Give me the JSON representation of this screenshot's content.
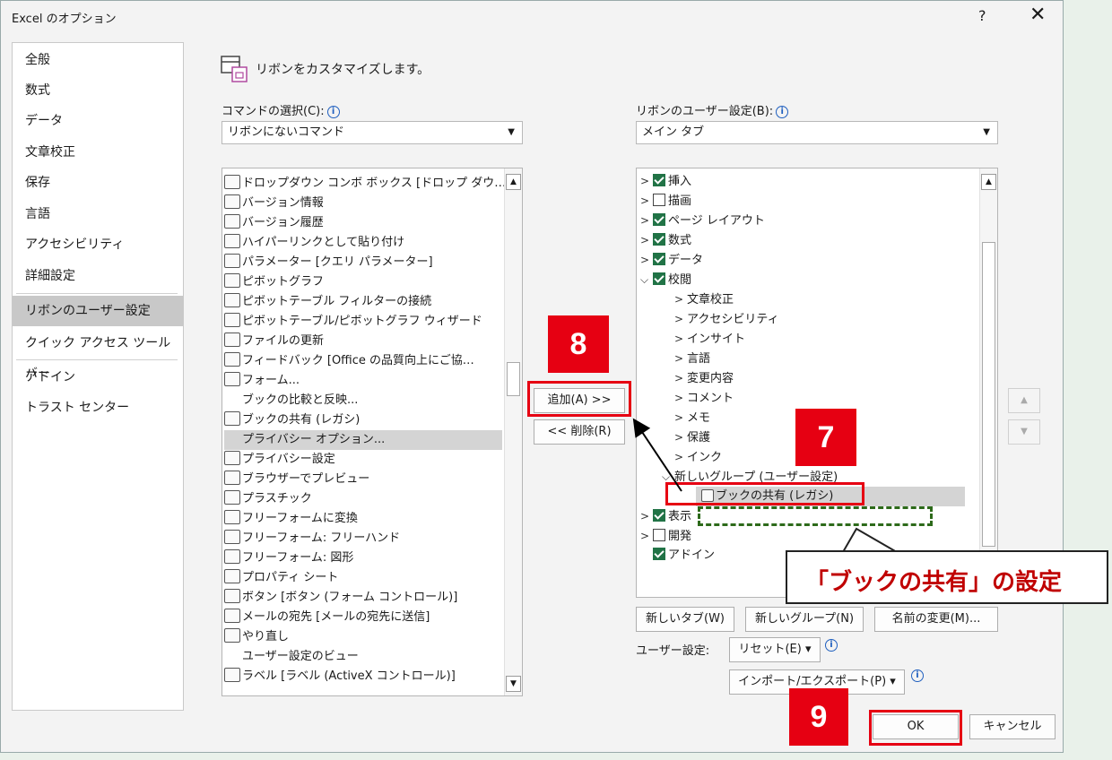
{
  "window": {
    "title": "Excel のオプション",
    "help": "?",
    "close": "✕"
  },
  "nav": [
    {
      "label": "全般"
    },
    {
      "label": "数式"
    },
    {
      "label": "データ"
    },
    {
      "label": "文章校正"
    },
    {
      "label": "保存"
    },
    {
      "label": "言語"
    },
    {
      "label": "アクセシビリティ"
    },
    {
      "label": "詳細設定"
    },
    {
      "label": "リボンのユーザー設定"
    },
    {
      "label": "クイック アクセス ツール バー"
    },
    {
      "label": "アドイン"
    },
    {
      "label": "トラスト センター"
    }
  ],
  "header": {
    "text": "リボンをカスタマイズします。"
  },
  "left": {
    "label": "コマンドの選択(C):",
    "combo": "リボンにないコマンド",
    "items": [
      "ドロップダウン コンボ ボックス [ドロップ ダウ…",
      "バージョン情報",
      "バージョン履歴",
      "ハイパーリンクとして貼り付け",
      "パラメーター [クエリ パラメーター]",
      "ピボットグラフ",
      "ピボットテーブル フィルターの接続",
      "ピボットテーブル/ピボットグラフ ウィザード",
      "ファイルの更新",
      "フィードバック [Office の品質向上にご協…",
      "フォーム...",
      "ブックの比較と反映...",
      "ブックの共有 (レガシ)",
      "プライバシー オプション...",
      "プライバシー設定",
      "ブラウザーでプレビュー",
      "プラスチック",
      "フリーフォームに変換",
      "フリーフォーム: フリーハンド",
      "フリーフォーム: 図形",
      "プロパティ シート",
      "ボタン [ボタン (フォーム コントロール)]",
      "メールの宛先 [メールの宛先に送信]",
      "やり直し",
      "ユーザー設定のビュー",
      "ラベル [ラベル (ActiveX コントロール)]"
    ]
  },
  "middle": {
    "add": "追加(A) >>",
    "remove": "<< 削除(R)"
  },
  "right": {
    "label": "リボンのユーザー設定(B):",
    "combo": "メイン タブ",
    "tree": [
      {
        "text": "挿入",
        "cb": true
      },
      {
        "text": "描画",
        "cb": false
      },
      {
        "text": "ページ レイアウト",
        "cb": true
      },
      {
        "text": "数式",
        "cb": true
      },
      {
        "text": "データ",
        "cb": true
      },
      {
        "text": "校閲",
        "cb": true
      },
      {
        "text": "文章校正"
      },
      {
        "text": "アクセシビリティ"
      },
      {
        "text": "インサイト"
      },
      {
        "text": "言語"
      },
      {
        "text": "変更内容"
      },
      {
        "text": "コメント"
      },
      {
        "text": "メモ"
      },
      {
        "text": "保護"
      },
      {
        "text": "インク"
      },
      {
        "text": "新しいグループ (ユーザー設定)"
      },
      {
        "text": "ブックの共有 (レガシ)"
      },
      {
        "text": "表示",
        "cb": true
      },
      {
        "text": "開発",
        "cb": false
      },
      {
        "text": "アドイン",
        "cb": true
      }
    ],
    "btn_new_tab": "新しいタブ(W)",
    "btn_new_group": "新しいグループ(N)",
    "btn_rename": "名前の変更(M)...",
    "user_settings_label": "ユーザー設定:",
    "reset": "リセット(E) ▾",
    "import_export": "インポート/エクスポート(P) ▾"
  },
  "footer": {
    "ok": "OK",
    "cancel": "キャンセル"
  },
  "annotations": {
    "badge7": "7",
    "badge8": "8",
    "badge9": "9",
    "callout": "「ブックの共有」の設定"
  }
}
